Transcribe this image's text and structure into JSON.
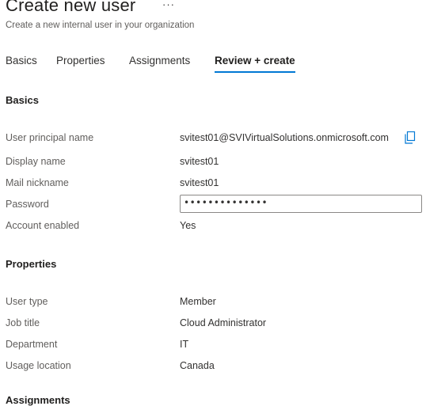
{
  "header": {
    "title": "Create new user",
    "more_label": "···",
    "subtitle": "Create a new internal user in your organization"
  },
  "tabs": [
    {
      "label": "Basics"
    },
    {
      "label": "Properties"
    },
    {
      "label": "Assignments"
    },
    {
      "label": "Review + create",
      "active": true
    }
  ],
  "basics": {
    "heading": "Basics",
    "fields": [
      {
        "label": "User principal name",
        "value": "svitest01@SVIVirtualSolutions.onmicrosoft.com",
        "icon": "copy-icon"
      },
      {
        "label": "Display name",
        "value": "svitest01"
      },
      {
        "label": "Mail nickname",
        "value": "svitest01"
      },
      {
        "label": "Password",
        "value": "••••••••••••••"
      },
      {
        "label": "Account enabled",
        "value": "Yes"
      }
    ]
  },
  "properties": {
    "heading": "Properties",
    "fields": [
      {
        "label": "User type",
        "value": "Member"
      },
      {
        "label": "Job title",
        "value": "Cloud Administrator"
      },
      {
        "label": "Department",
        "value": "IT"
      },
      {
        "label": "Usage location",
        "value": "Canada"
      }
    ]
  },
  "next_section": {
    "heading": "Assignments"
  },
  "colors": {
    "accent": "#0078d4",
    "text": "#323130",
    "muted": "#605e5c"
  }
}
